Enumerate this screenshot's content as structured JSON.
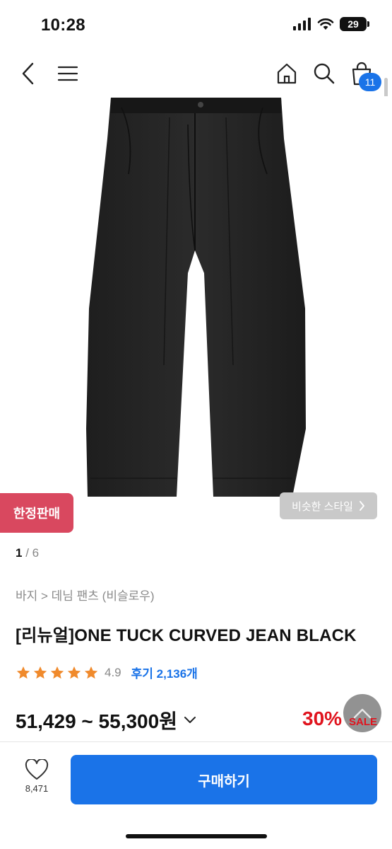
{
  "status": {
    "time": "10:28",
    "battery": "29"
  },
  "nav": {
    "cart_count": "11"
  },
  "product": {
    "badge": "한정판매",
    "similar_style": "비슷한 스타일",
    "pager_current": "1",
    "pager_separator": "/",
    "pager_total": "6",
    "breadcrumb": "바지 > 데님 팬츠 (비슬로우)",
    "title": "[리뉴얼]ONE TUCK CURVED JEAN BLACK",
    "rating": {
      "stars": 5,
      "value": "4.9",
      "reviews": "후기 2,136개"
    },
    "price": "51,429 ~ 55,300원",
    "discount": "30%",
    "sale_label": "SALE"
  },
  "bottom": {
    "like_count": "8,471",
    "buy_label": "구매하기"
  },
  "colors": {
    "accent": "#1a73e8",
    "badge": "#d9485f",
    "discount": "#e0141e",
    "star": "#f08a2c"
  }
}
